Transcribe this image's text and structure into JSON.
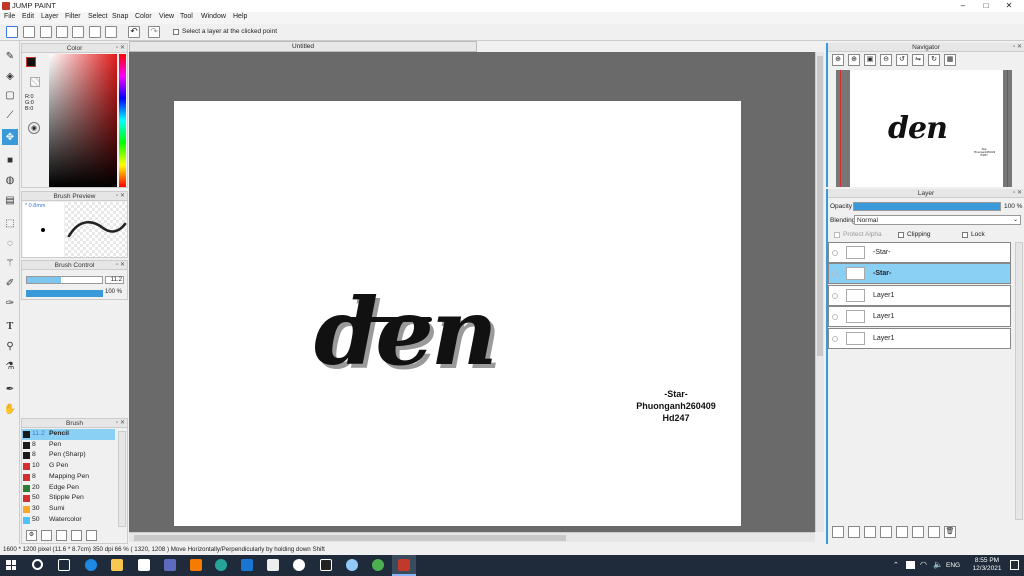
{
  "window": {
    "title": "JUMP PAINT",
    "minimize": "–",
    "maximize": "□",
    "close": "✕"
  },
  "menu": [
    "File",
    "Edit",
    "Layer",
    "Filter",
    "Select",
    "Snap",
    "Color",
    "View",
    "Tool",
    "Window",
    "Help"
  ],
  "toolbar": {
    "select_layer_option": "Select a layer at the clicked point"
  },
  "document": {
    "tab_title": "Untitled"
  },
  "panels": {
    "color": {
      "title": "Color",
      "r_label": "R:0",
      "g_label": "G:0",
      "b_label": "B:0",
      "current_color": "#111111"
    },
    "brush_preview": {
      "title": "Brush Preview",
      "size_label": "* 0.8mm"
    },
    "brush_control": {
      "title": "Brush Control",
      "size_value": "11.2",
      "opacity_value": "100 %",
      "size_fraction": 0.45,
      "opacity_fraction": 1.0
    },
    "brush": {
      "title": "Brush",
      "items": [
        {
          "size": "11.2",
          "name": "Pencil",
          "color": "#1a1a1a",
          "selected": true
        },
        {
          "size": "8",
          "name": "Pen",
          "color": "#1a1a1a"
        },
        {
          "size": "8",
          "name": "Pen (Sharp)",
          "color": "#1a1a1a"
        },
        {
          "size": "10",
          "name": "G Pen",
          "color": "#d32f2f"
        },
        {
          "size": "8",
          "name": "Mapping Pen",
          "color": "#d32f2f"
        },
        {
          "size": "20",
          "name": "Edge Pen",
          "color": "#2e7d32"
        },
        {
          "size": "50",
          "name": "Stipple Pen",
          "color": "#d32f2f"
        },
        {
          "size": "30",
          "name": "Sumi",
          "color": "#f9a825"
        },
        {
          "size": "50",
          "name": "Watercolor",
          "color": "#4fc3f7"
        }
      ]
    },
    "navigator": {
      "title": "Navigator"
    },
    "layer": {
      "title": "Layer",
      "opacity_label": "Opacity",
      "opacity_value": "100 %",
      "opacity_fraction": 1.0,
      "blending_label": "Blending",
      "blending_value": "Normal",
      "protect_alpha": "Protect Alpha",
      "clipping": "Clipping",
      "lock": "Lock",
      "layers": [
        {
          "name": "-Star-",
          "selected": false
        },
        {
          "name": "-Star-",
          "selected": true
        },
        {
          "name": "Layer1",
          "selected": false
        },
        {
          "name": "Layer1",
          "selected": false
        },
        {
          "name": "Layer1",
          "selected": false
        }
      ]
    }
  },
  "artwork": {
    "main_text": "den",
    "signature_lines": [
      "-Star-",
      "Phuonganh260409",
      "Hd247"
    ]
  },
  "status": {
    "text": "1600 * 1200 pixel   (11.6 * 8.7cm)   350 dpi   66 %   ( 1320, 1208 )   Move Horizontally/Perpendicularly by holding down Shift"
  },
  "taskbar": {
    "language": "ENG",
    "time": "8:55 PM",
    "date": "12/3/2021"
  },
  "colors": {
    "accent": "#3a9ad9",
    "selected_layer": "#8ad0f5",
    "taskbar": "#1f2b3a",
    "canvas_bg": "#6a6a6a"
  }
}
